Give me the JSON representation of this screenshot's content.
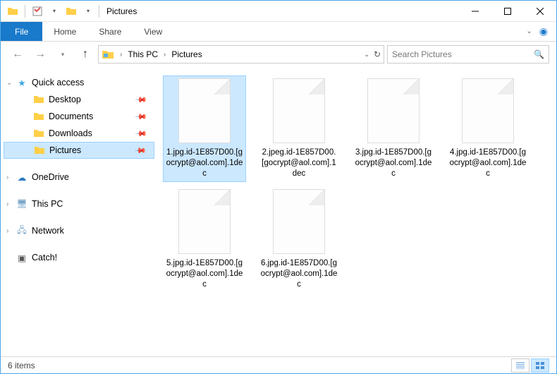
{
  "titlebar": {
    "title": "Pictures"
  },
  "ribbon": {
    "file": "File",
    "tabs": [
      "Home",
      "Share",
      "View"
    ]
  },
  "address": {
    "crumbs": [
      "This PC",
      "Pictures"
    ]
  },
  "search": {
    "placeholder": "Search Pictures"
  },
  "sidebar": {
    "quick_access": "Quick access",
    "quick_items": [
      {
        "label": "Desktop",
        "pinned": true
      },
      {
        "label": "Documents",
        "pinned": true
      },
      {
        "label": "Downloads",
        "pinned": true
      },
      {
        "label": "Pictures",
        "pinned": true,
        "selected": true
      }
    ],
    "onedrive": "OneDrive",
    "thispc": "This PC",
    "network": "Network",
    "catch": "Catch!"
  },
  "files": [
    {
      "name": "1.jpg.id-1E857D00.[gocrypt@aol.com].1dec",
      "selected": true
    },
    {
      "name": "2.jpeg.id-1E857D00.[gocrypt@aol.com].1dec"
    },
    {
      "name": "3.jpg.id-1E857D00.[gocrypt@aol.com].1dec"
    },
    {
      "name": "4.jpg.id-1E857D00.[gocrypt@aol.com].1dec"
    },
    {
      "name": "5.jpg.id-1E857D00.[gocrypt@aol.com].1dec"
    },
    {
      "name": "6.jpg.id-1E857D00.[gocrypt@aol.com].1dec"
    }
  ],
  "statusbar": {
    "count": "6 items"
  }
}
